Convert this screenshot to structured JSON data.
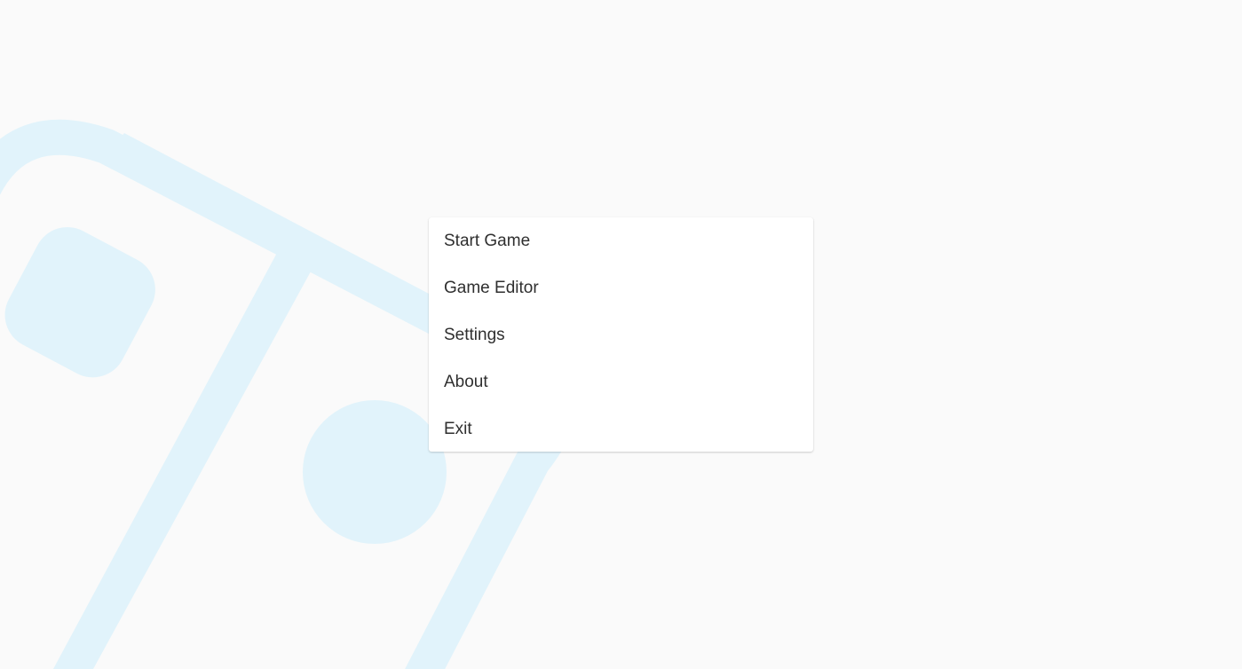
{
  "background": {
    "color": "#fafafa",
    "art_color": "#e1f3fb",
    "art": "game-controller-outline"
  },
  "menu": {
    "items": [
      {
        "id": "start-game",
        "label": "Start Game"
      },
      {
        "id": "game-editor",
        "label": "Game Editor"
      },
      {
        "id": "settings",
        "label": "Settings"
      },
      {
        "id": "about",
        "label": "About"
      },
      {
        "id": "exit",
        "label": "Exit"
      }
    ]
  }
}
